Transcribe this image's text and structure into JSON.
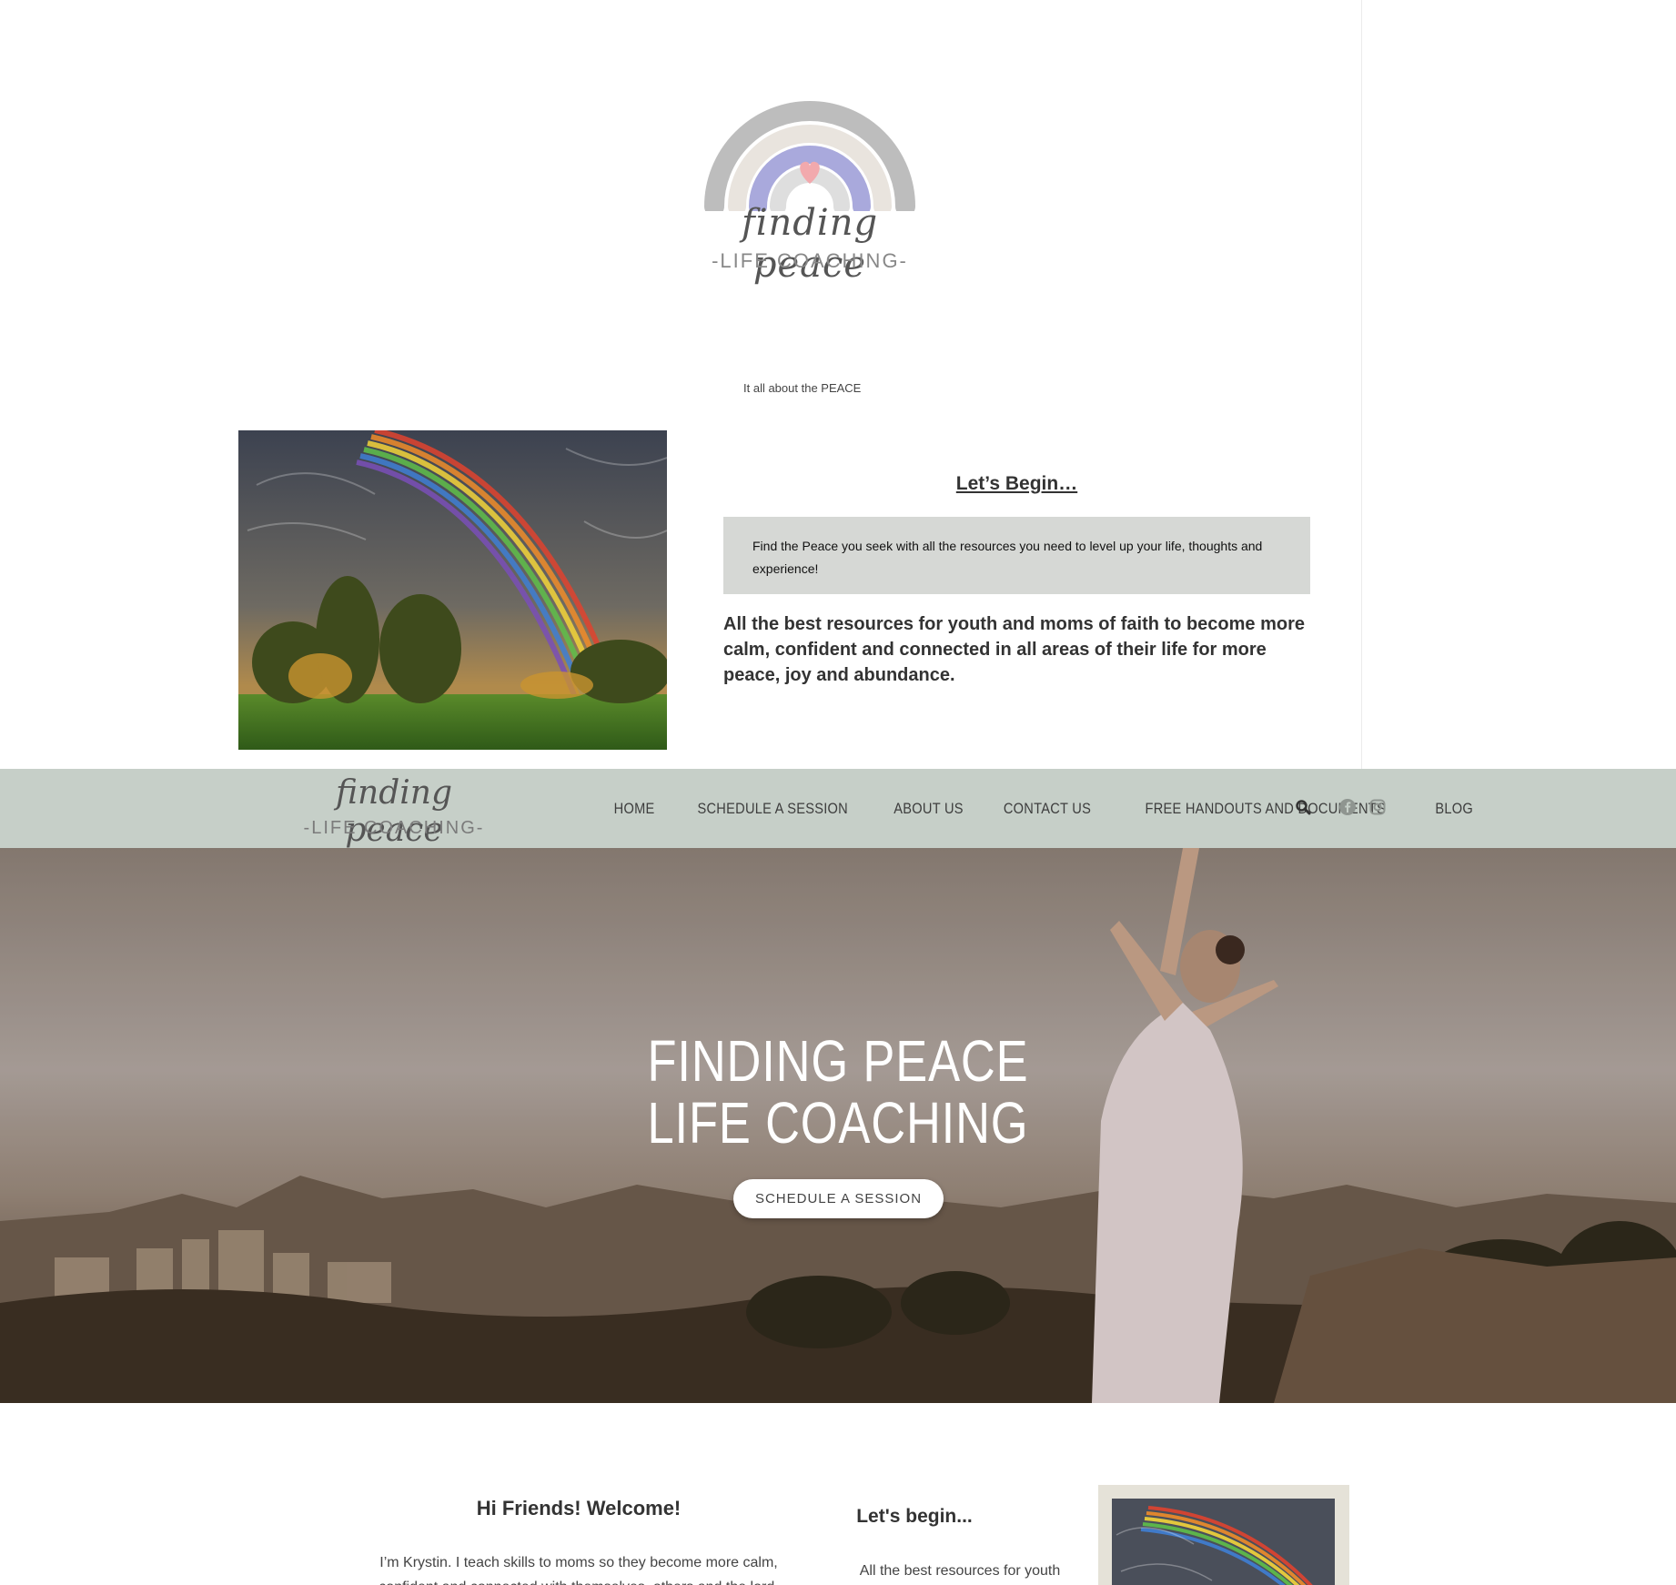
{
  "logo": {
    "script": "finding peace",
    "sub": "-LIFE COACHING-"
  },
  "tagline": "It all about the PEACE",
  "intro": {
    "heading": "Let’s Begin…",
    "box_text": "Find the Peace you seek with all the resources you need to level up your life, thoughts and experience!",
    "body": "All the best resources for youth and moms of faith to become more calm, confident and connected in all areas of their life for more peace, joy and abundance."
  },
  "nav": {
    "logo_script": "finding peace",
    "logo_sub": "-LIFE COACHING-",
    "items": [
      "HOME",
      "SCHEDULE A SESSION",
      "ABOUT US",
      "CONTACT US",
      "FREE HANDOUTS AND DOCUMENTS",
      "BLOG"
    ],
    "icons": [
      "search-icon",
      "facebook-icon",
      "instagram-icon"
    ]
  },
  "hero": {
    "title_line1": "FINDING PEACE",
    "title_line2": "LIFE COACHING",
    "button": "SCHEDULE A SESSION"
  },
  "welcome": {
    "title": "Hi Friends! Welcome!",
    "text": "I’m Krystin. I teach skills to moms so they become more calm, confident and connected with themselves, others and the lord."
  },
  "side": {
    "heading": "Let's begin...",
    "text": "All the best resources for youth and"
  },
  "colors": {
    "nav_bg": "#c6cfc8",
    "gray_box": "#d6d8d5",
    "frame": "#e5e2d8"
  }
}
